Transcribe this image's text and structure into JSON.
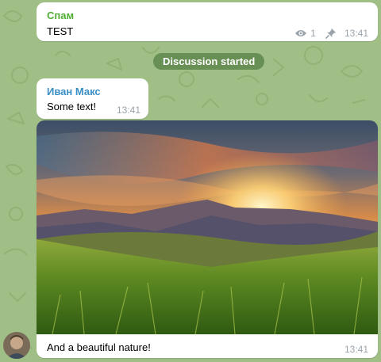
{
  "messages": {
    "spam": {
      "sender": "Спам",
      "text": "TEST",
      "views": "1",
      "time": "13:41",
      "icons": [
        "eye-icon",
        "pin-icon"
      ]
    },
    "service": {
      "text": "Discussion started"
    },
    "ivan": {
      "sender": "Иван Макс",
      "text": "Some text!",
      "time": "13:41"
    },
    "photo": {
      "caption": "And a beautiful nature!",
      "time": "13:41"
    }
  },
  "colors": {
    "background": "#9fbf86",
    "spam_sender": "#4fae33",
    "ivan_sender": "#3a8fc7",
    "time": "#9aa3ab"
  }
}
